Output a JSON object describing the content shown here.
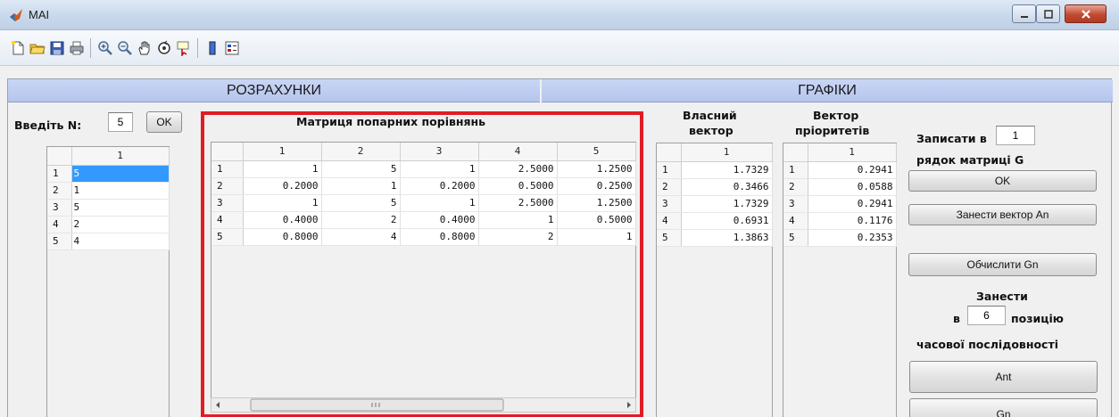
{
  "window": {
    "title": "MAI"
  },
  "toolbar": {
    "icons": [
      "new-file-icon",
      "open-folder-icon",
      "save-icon",
      "print-icon",
      "zoom-in-icon",
      "zoom-out-icon",
      "pan-hand-icon",
      "rotate-3d-icon",
      "data-cursor-icon",
      "colorbar-icon",
      "legend-icon"
    ]
  },
  "headers": {
    "left": "РОЗРАХУНКИ",
    "right": "ГРАФІКИ"
  },
  "input_n": {
    "label": "Введіть N:",
    "value": "5",
    "ok_label": "OK"
  },
  "vector_table": {
    "col_header": "1",
    "rows": [
      "1",
      "2",
      "3",
      "4",
      "5"
    ],
    "values": [
      "5",
      "1",
      "5",
      "2",
      "4"
    ]
  },
  "matrix": {
    "title": "Матриця попарних порівнянь",
    "col_headers": [
      "1",
      "2",
      "3",
      "4",
      "5"
    ],
    "row_headers": [
      "1",
      "2",
      "3",
      "4",
      "5"
    ],
    "rows": [
      [
        "1",
        "5",
        "1",
        "2.5000",
        "1.2500"
      ],
      [
        "0.2000",
        "1",
        "0.2000",
        "0.5000",
        "0.2500"
      ],
      [
        "1",
        "5",
        "1",
        "2.5000",
        "1.2500"
      ],
      [
        "0.4000",
        "2",
        "0.4000",
        "1",
        "0.5000"
      ],
      [
        "0.8000",
        "4",
        "0.8000",
        "2",
        "1"
      ]
    ]
  },
  "eigen": {
    "title_line1": "Власний",
    "title_line2": "вектор",
    "col_header": "1",
    "rows": [
      "1",
      "2",
      "3",
      "4",
      "5"
    ],
    "values": [
      "1.7329",
      "0.3466",
      "1.7329",
      "0.6931",
      "1.3863"
    ]
  },
  "priority": {
    "title_line1": "Вектор",
    "title_line2": "пріоритетів",
    "col_header": "1",
    "rows": [
      "1",
      "2",
      "3",
      "4",
      "5"
    ],
    "values": [
      "0.2941",
      "0.0588",
      "0.2941",
      "0.1176",
      "0.2353"
    ]
  },
  "right_panel": {
    "write_label": "Записати в",
    "write_value": "1",
    "row_label": "рядок матриці G",
    "ok_label": "OK",
    "add_vector_label": "Занести вектор An",
    "compute_label": "Обчислити Gn",
    "add_label": "Занести",
    "in_label": "в",
    "position_value": "6",
    "position_label": "позицію",
    "series_label": "часової послідовності",
    "ant_label": "Ant",
    "gn_label": "Gn"
  }
}
